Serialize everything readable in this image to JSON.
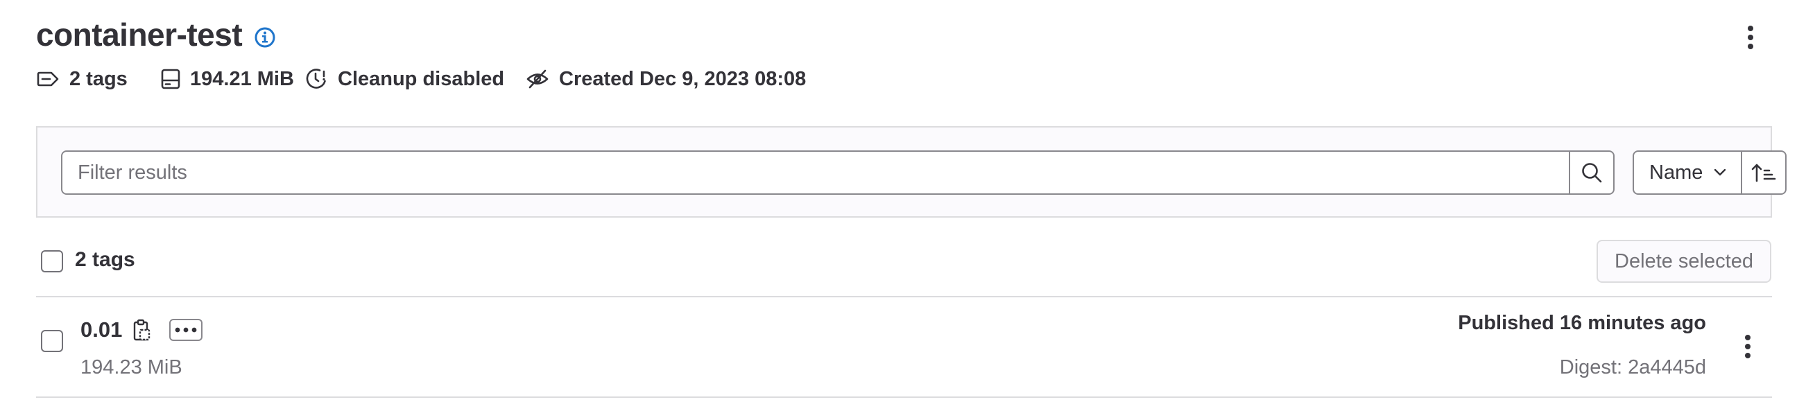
{
  "header": {
    "title": "container-test",
    "info_icon": "info-circle-icon",
    "more_actions_icon": "ellipsis-v-icon"
  },
  "meta": {
    "tags": "2 tags",
    "size": "194.21 MiB",
    "cleanup": "Cleanup disabled",
    "created": "Created Dec 9, 2023 08:08"
  },
  "filter": {
    "placeholder": "Filter results",
    "search_icon": "search-icon",
    "sort_label": "Name",
    "sort_direction_icon": "sort-lowest-icon"
  },
  "list": {
    "count_label": "2 tags",
    "delete_selected_label": "Delete selected",
    "rows": [
      {
        "name": "0.01",
        "size": "194.23 MiB",
        "published": "Published 16 minutes ago",
        "digest": "Digest: 2a4445d"
      }
    ]
  },
  "colors": {
    "text": "#333238",
    "muted": "#737278",
    "border": "#dcdcde",
    "info_blue": "#1f75cb",
    "panel_bg": "#fbfafd"
  }
}
